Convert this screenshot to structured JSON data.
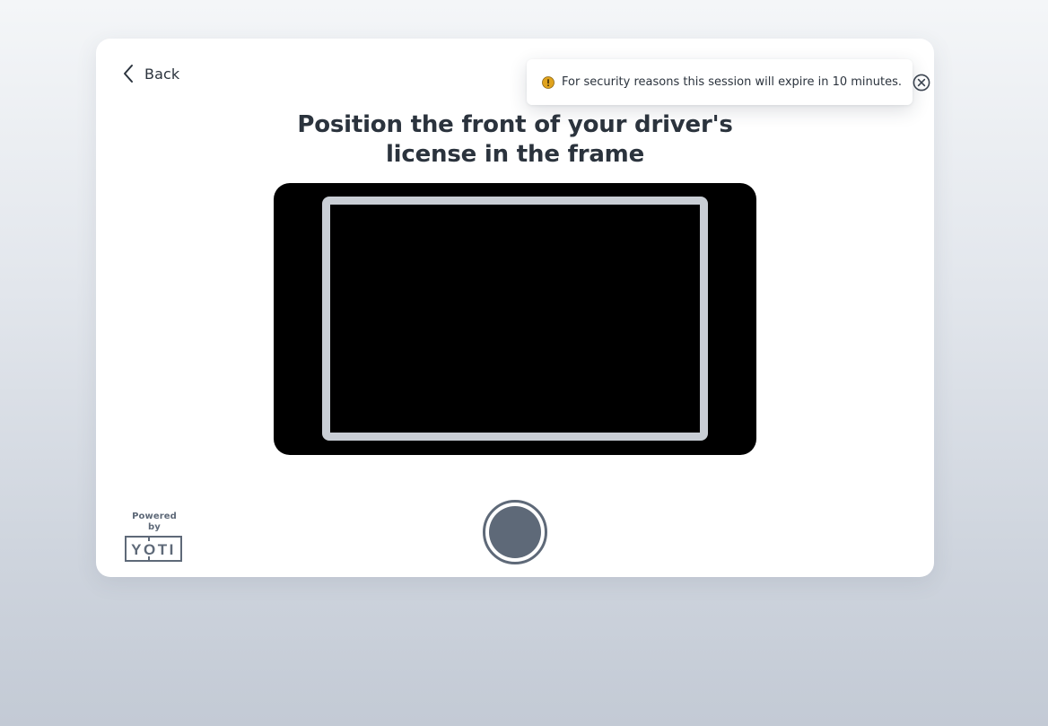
{
  "nav": {
    "back_label": "Back",
    "back_icon": "chevron-left-icon"
  },
  "notification": {
    "icon": "warning-icon",
    "icon_color": "#e0a31d",
    "message": "For security reasons this session will expire in 10 minutes.",
    "close_icon": "close-circle-icon"
  },
  "page": {
    "title": "Position the front of your driver's license in the frame"
  },
  "camera": {
    "background_color": "#000000",
    "frame_color": "#c9ced5"
  },
  "capture": {
    "icon": "shutter-icon",
    "color": "#5e6978"
  },
  "branding": {
    "powered_by": "Powered by",
    "logo_text": "YOTI"
  }
}
